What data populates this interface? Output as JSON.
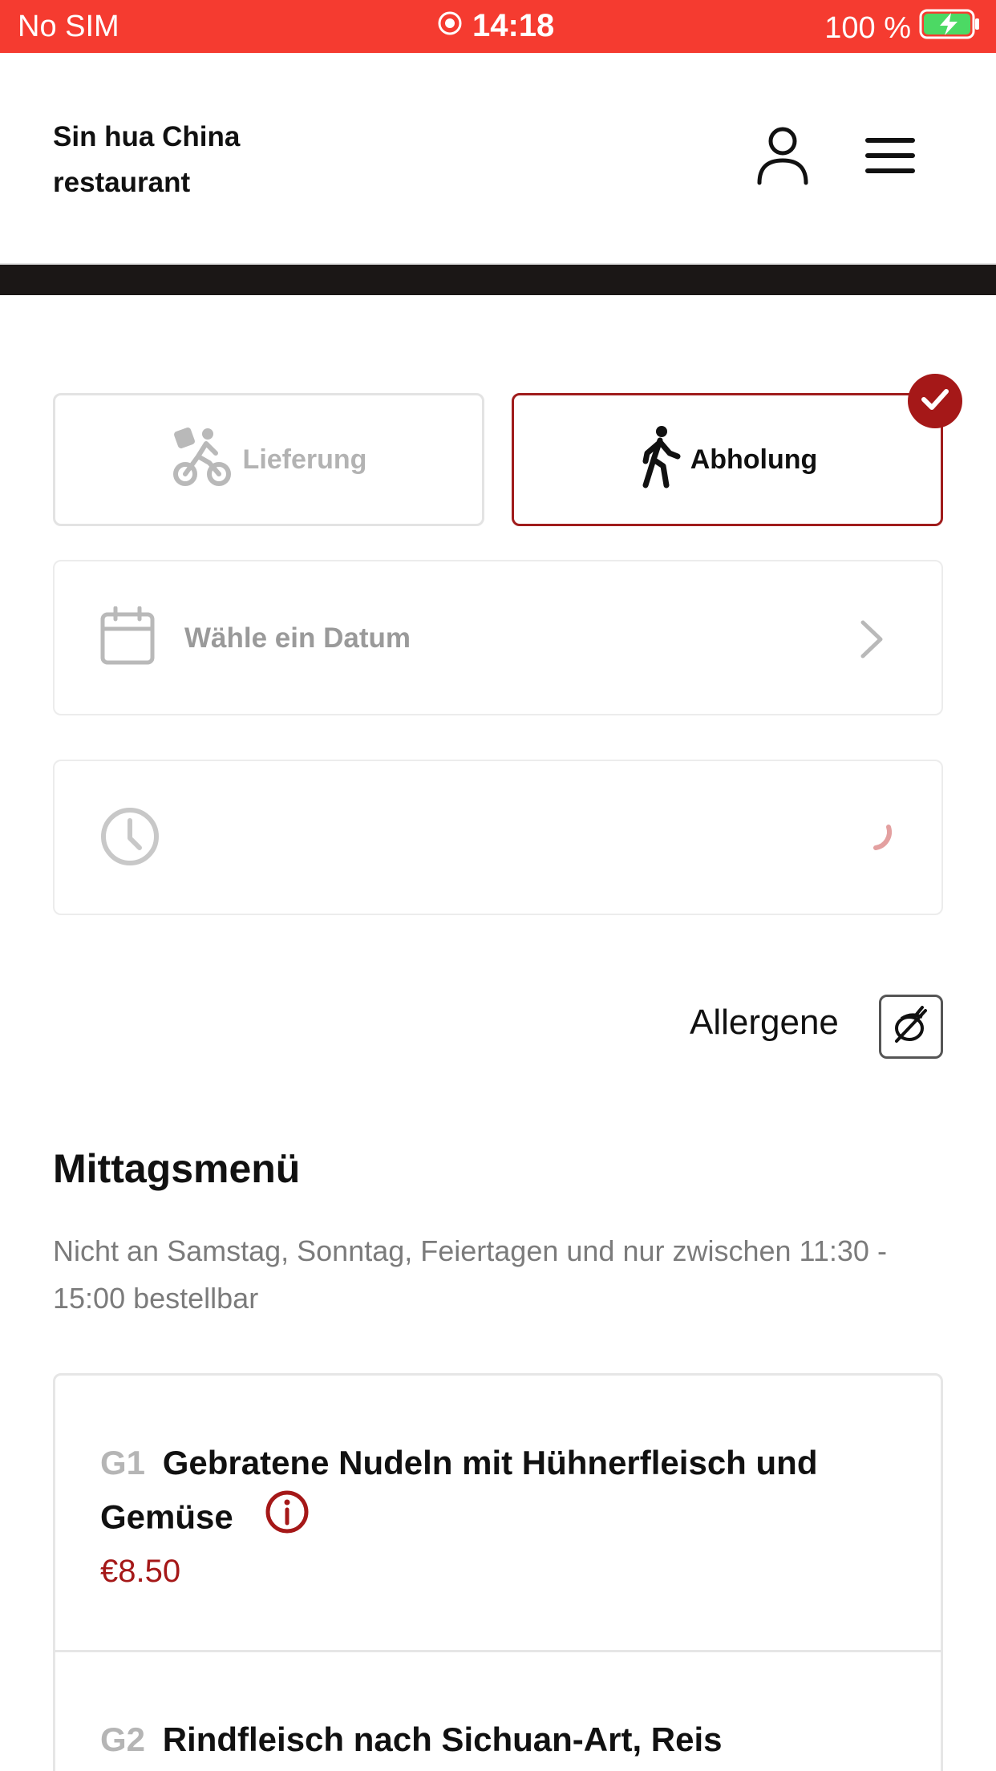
{
  "status_bar": {
    "carrier": "No SIM",
    "time": "14:18",
    "battery": "100 %"
  },
  "header": {
    "restaurant_name": "Sin hua China restaurant",
    "icons": [
      "user-icon",
      "menu-icon"
    ]
  },
  "order_mode": {
    "options": [
      {
        "label": "Lieferung",
        "icon": "bicycle-delivery-icon",
        "selected": false
      },
      {
        "label": "Abholung",
        "icon": "walking-person-icon",
        "selected": true
      }
    ]
  },
  "date_selector": {
    "placeholder": "Wähle ein Datum",
    "icon": "calendar-icon"
  },
  "time_selector": {
    "icon": "clock-icon",
    "loading": true
  },
  "allergens": {
    "label": "Allergene",
    "icon": "allergen-filter-icon"
  },
  "menu_section": {
    "title": "Mittagsmenü",
    "description": "Nicht an Samstag, Sonntag, Feiertagen und nur zwischen 11:30 - 15:00 bestellbar",
    "items": [
      {
        "code": "G1",
        "name": "Gebratene Nudeln mit Hühnerfleisch und Gemüse",
        "price": "€8.50"
      },
      {
        "code": "G2",
        "name": "Rindfleisch nach Sichuan-Art, Reis",
        "price": ""
      }
    ]
  },
  "colors": {
    "status_bar": "#f53b30",
    "accent": "#a51818",
    "muted_text": "#7b7b7b",
    "border": "#e6e6e6"
  }
}
